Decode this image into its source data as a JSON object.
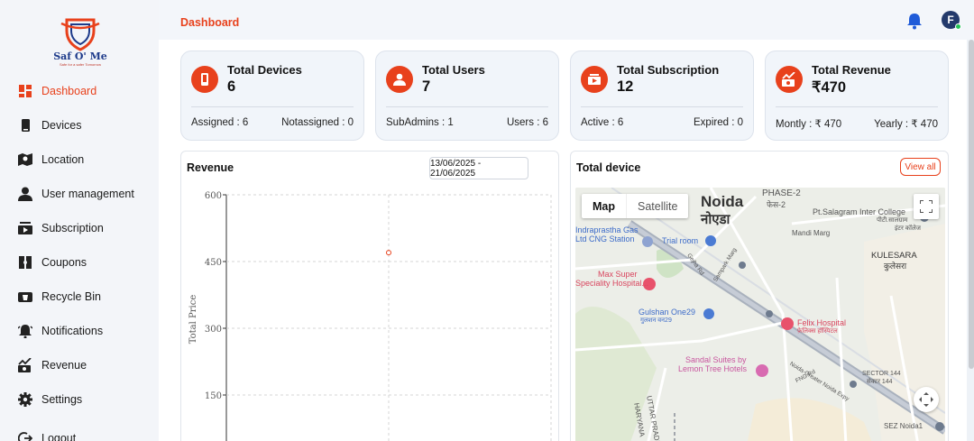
{
  "app": {
    "brand": "Saf O' Me",
    "tagline": "Safe for a safer Tomorrow"
  },
  "colors": {
    "accent": "#e8411c",
    "sidebar_bg": "#f3f5f9",
    "card_bg": "#f1f5fa"
  },
  "sidebar": {
    "items": [
      {
        "label": "Dashboard",
        "icon": "dashboard-icon",
        "active": true
      },
      {
        "label": "Devices",
        "icon": "device-icon"
      },
      {
        "label": "Location",
        "icon": "map-icon"
      },
      {
        "label": "User management",
        "icon": "user-icon"
      },
      {
        "label": "Subscription",
        "icon": "subscription-icon"
      },
      {
        "label": "Coupons",
        "icon": "coupon-icon"
      },
      {
        "label": "Recycle Bin",
        "icon": "recycle-bin-icon"
      },
      {
        "label": "Notifications",
        "icon": "notification-icon"
      },
      {
        "label": "Revenue",
        "icon": "revenue-icon"
      },
      {
        "label": "Settings",
        "icon": "gear-icon"
      },
      {
        "label": "Logout",
        "icon": "logout-icon"
      }
    ]
  },
  "header": {
    "title": "Dashboard",
    "avatar_initial": "F"
  },
  "cards": [
    {
      "title": "Total Devices",
      "value": "6",
      "left": "Assigned : 6",
      "right": "Notassigned : 0",
      "icon": "device-icon"
    },
    {
      "title": "Total Users",
      "value": "7",
      "left": "SubAdmins : 1",
      "right": "Users : 6",
      "icon": "user-icon"
    },
    {
      "title": "Total Subscription",
      "value": "12",
      "left": "Active : 6",
      "right": "Expired : 0",
      "icon": "subscription-icon"
    },
    {
      "title": "Total Revenue",
      "value": "₹470",
      "left": "Montly : ₹ 470",
      "right": "Yearly : ₹ 470",
      "icon": "revenue-icon"
    }
  ],
  "revenue": {
    "title": "Revenue",
    "date_range": "13/06/2025 - 21/06/2025"
  },
  "chart_data": {
    "type": "scatter",
    "title": "",
    "xlabel": "",
    "ylabel": "Total Price",
    "y_ticks": [
      "600",
      "450",
      "300",
      "150"
    ],
    "ylim": [
      0,
      600
    ],
    "xlim": [
      0,
      2
    ],
    "grid": true,
    "series": [
      {
        "x": [
          1
        ],
        "y": [
          470
        ]
      }
    ],
    "marker_color": "#e8411c"
  },
  "device": {
    "title": "Total device",
    "view_all": "View all",
    "map_type": {
      "map": "Map",
      "satellite": "Satellite"
    },
    "labels": {
      "l1": "Noida",
      "l2": "नोएडा",
      "l3": "PHASE-2",
      "l4": "फेस-2",
      "l5": "Pt.Salagram Inter College",
      "l6": "पीटी.सालग्राम",
      "l7": "इंटर कॉलेज",
      "l8": "Mandi Marg",
      "l9": "KULESARA",
      "l10": "कुलेसरा",
      "l11": "Indraprastha Gas",
      "l12": "Ltd CNG Station",
      "l13": "Trial room",
      "l14": "Max Super",
      "l15": "Speciality Hospital...",
      "l16": "Gulshan One29",
      "l17": "गुलशन वन29",
      "l18": "Felix Hospital",
      "l19": "फ़ेलिक्स हॉस्पिटल",
      "l20": "Sandal Suites by",
      "l21": "Lemon Tree Hotels",
      "l22": "SECTOR 144",
      "l23": "सेक्टर 144",
      "l24": "UTTAR PRADESH",
      "l25": "HARYANA",
      "l26": "SEZ Noida1",
      "l27": "Noida-Greater Noida Expy",
      "l28": "Gejha Rd",
      "l29": "Sampark Marg",
      "l30": "FNG Rd"
    }
  }
}
